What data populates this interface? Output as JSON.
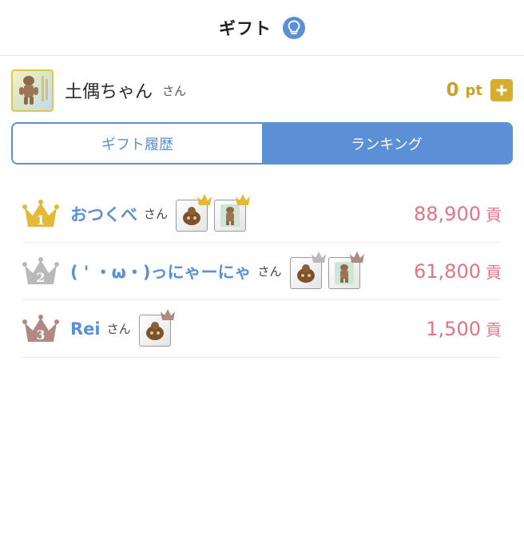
{
  "header": {
    "title": "ギフト",
    "hint_icon": "lightbulb-icon"
  },
  "user": {
    "name": "土偶ちゃん",
    "honorific": "さん",
    "points": "0",
    "points_unit": "pt",
    "add_icon": "plus-icon"
  },
  "tabs": [
    {
      "label": "ギフト履歴",
      "active": false
    },
    {
      "label": "ランキング",
      "active": true
    }
  ],
  "ranking": [
    {
      "rank": "1",
      "name": "おつくべ",
      "honorific": "さん",
      "score": "88,900",
      "unit": "貢",
      "badge_count": 2,
      "crown_color": "#e3b935"
    },
    {
      "rank": "2",
      "name": "( ' ・ω・)っにゃーにゃ",
      "honorific": "さん",
      "score": "61,800",
      "unit": "貢",
      "badge_count": 2,
      "crown_color": "#b9b9b9"
    },
    {
      "rank": "3",
      "name": "Rei",
      "honorific": "さん",
      "score": "1,500",
      "unit": "貢",
      "badge_count": 1,
      "crown_color": "#b08a82"
    }
  ],
  "colors": {
    "accent": "#5b8fd6",
    "gold": "#c9a227",
    "score": "#e07585"
  }
}
